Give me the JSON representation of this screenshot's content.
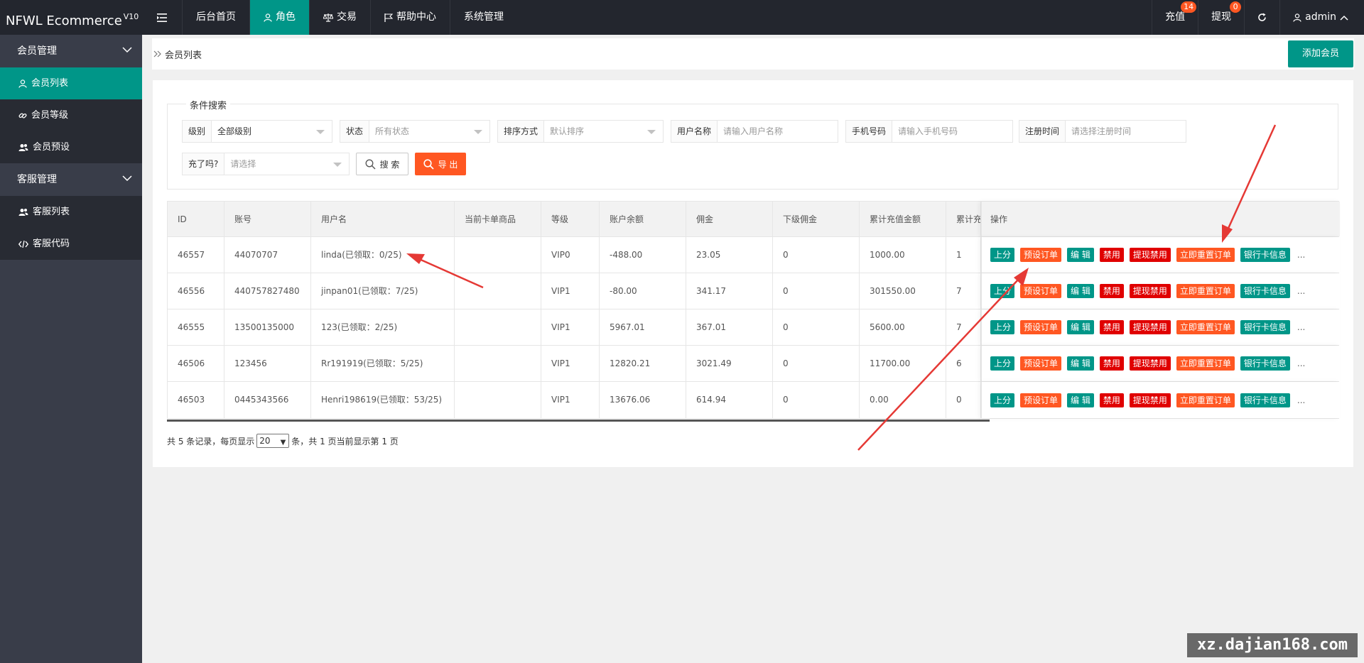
{
  "header": {
    "logo": "NFWL Ecommerce",
    "logo_version": "V10",
    "nav": [
      "后台首页",
      "角色",
      "交易",
      "帮助中心",
      "系统管理"
    ],
    "recharge_label": "充值",
    "recharge_badge": "14",
    "withdraw_label": "提现",
    "withdraw_badge": "0",
    "user_label": "admin"
  },
  "sidebar": {
    "group1": "会员管理",
    "group1_items": [
      "会员列表",
      "会员等级",
      "会员预设"
    ],
    "group2": "客服管理",
    "group2_items": [
      "客服列表",
      "客服代码"
    ]
  },
  "breadcrumb": "会员列表",
  "add_button": "添加会员",
  "search": {
    "legend": "条件搜索",
    "level_label": "级别",
    "level_value": "全部级别",
    "status_label": "状态",
    "status_placeholder": "所有状态",
    "sort_label": "排序方式",
    "sort_placeholder": "默认排序",
    "username_label": "用户名称",
    "username_placeholder": "请输入用户名称",
    "phone_label": "手机号码",
    "phone_placeholder": "请输入手机号码",
    "regtime_label": "注册时间",
    "regtime_placeholder": "请选择注册时间",
    "recharged_label": "充了吗?",
    "recharged_placeholder": "请选择",
    "search_button": "搜 索",
    "export_button": "导 出"
  },
  "table": {
    "columns": [
      "ID",
      "账号",
      "用户名",
      "当前卡单商品",
      "等级",
      "账户余额",
      "佣金",
      "下级佣金",
      "累计充值金额",
      "累计充值",
      "操作"
    ],
    "ops": [
      "上分",
      "预设订单",
      "编 辑",
      "禁用",
      "提现禁用",
      "立即重置订单",
      "银行卡信息"
    ],
    "more": "...",
    "rows": [
      [
        "46557",
        "44070707",
        "linda(已领取：0/25)",
        "",
        "VIP0",
        "-488.00",
        "23.05",
        "0",
        "1000.00",
        "1"
      ],
      [
        "46556",
        "440757827480",
        "jinpan01(已领取：7/25)",
        "",
        "VIP1",
        "-80.00",
        "341.17",
        "0",
        "301550.00",
        "7"
      ],
      [
        "46555",
        "13500135000",
        "123(已领取：2/25)",
        "",
        "VIP1",
        "5967.01",
        "367.01",
        "0",
        "5600.00",
        "7"
      ],
      [
        "46506",
        "123456",
        "Rr191919(已领取：5/25)",
        "",
        "VIP1",
        "12820.21",
        "3021.49",
        "0",
        "11700.00",
        "6"
      ],
      [
        "46503",
        "0445343566",
        "Henri198619(已领取：53/25)",
        "",
        "VIP1",
        "13676.06",
        "614.94",
        "0",
        "0.00",
        "0"
      ]
    ]
  },
  "pager": {
    "prefix": "共 5 条记录，每页显示",
    "page_size": "20",
    "suffix": "条，共 1 页当前显示第 1 页"
  },
  "watermark": "xz.dajian168.com",
  "colors": {
    "primary": "#009688",
    "orange": "#ff5722",
    "red": "#e00000",
    "header": "#23262e",
    "sidebar": "#393d49"
  }
}
